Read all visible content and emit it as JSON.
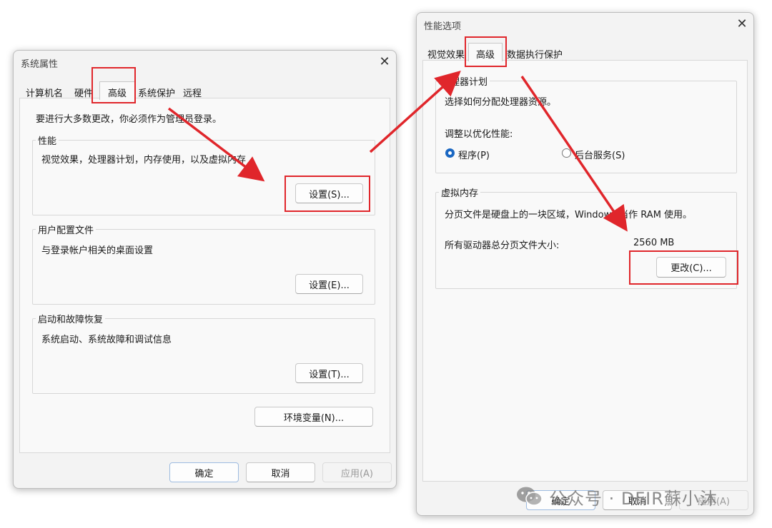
{
  "sysprops": {
    "title": "系统属性",
    "tabs": [
      "计算机名",
      "硬件",
      "高级",
      "系统保护",
      "远程"
    ],
    "admin_note": "要进行大多数更改，你必须作为管理员登录。",
    "performance": {
      "title": "性能",
      "desc": "视觉效果，处理器计划，内存使用，以及虚拟内存",
      "button": "设置(S)..."
    },
    "profiles": {
      "title": "用户配置文件",
      "desc": "与登录帐户相关的桌面设置",
      "button": "设置(E)..."
    },
    "startup": {
      "title": "启动和故障恢复",
      "desc": "系统启动、系统故障和调试信息",
      "button": "设置(T)..."
    },
    "env_button": "环境变量(N)...",
    "ok": "确定",
    "cancel": "取消",
    "apply": "应用(A)"
  },
  "perfopts": {
    "title": "性能选项",
    "tabs": [
      "视觉效果",
      "高级",
      "数据执行保护"
    ],
    "scheduler": {
      "title": "处理器计划",
      "desc": "选择如何分配处理器资源。",
      "adjust_label": "调整以优化性能:",
      "option_programs": "程序(P)",
      "option_services": "后台服务(S)"
    },
    "vmem": {
      "title": "虚拟内存",
      "desc": "分页文件是硬盘上的一块区域，Windows 当作 RAM 使用。",
      "total_label": "所有驱动器总分页文件大小:",
      "total_value": "2560 MB",
      "change_button": "更改(C)..."
    },
    "ok": "确定",
    "cancel": "取消",
    "apply": "应用(A)"
  },
  "watermark": "公众号 · DFIR蘇小沐",
  "colors": {
    "annotation_red": "#e0262b",
    "radio_accent": "#1a67c2"
  }
}
